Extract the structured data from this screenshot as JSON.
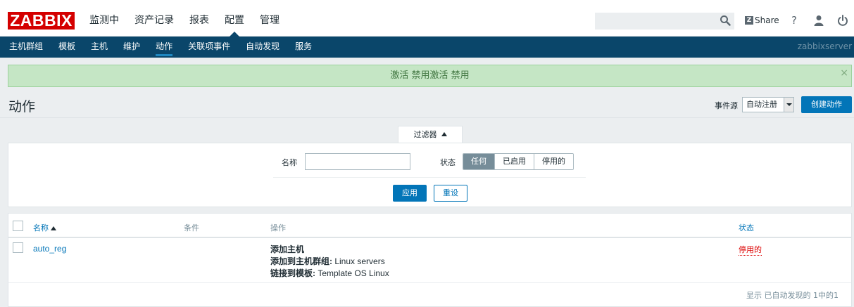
{
  "header": {
    "logo": "ZABBIX",
    "nav": [
      "监测中",
      "资产记录",
      "报表",
      "配置",
      "管理"
    ],
    "active_nav": "配置",
    "share_label": "Share",
    "help_label": "?"
  },
  "subnav": {
    "items": [
      "主机群组",
      "模板",
      "主机",
      "维护",
      "动作",
      "关联项事件",
      "自动发现",
      "服务"
    ],
    "active": "动作",
    "server": "zabbixserver"
  },
  "message": {
    "text": "激活 禁用激活 禁用",
    "close": "×"
  },
  "page": {
    "title": "动作",
    "source_label": "事件源",
    "source_value": "自动注册",
    "create_button": "创建动作"
  },
  "filter": {
    "tab_label": "过滤器",
    "name_label": "名称",
    "name_value": "",
    "status_label": "状态",
    "status_options": [
      "任何",
      "已启用",
      "停用的"
    ],
    "status_selected": "任何",
    "apply": "应用",
    "reset": "重设"
  },
  "table": {
    "columns": [
      "名称",
      "条件",
      "操作",
      "状态"
    ],
    "rows": [
      {
        "name": "auto_reg",
        "conditions": "",
        "operations": [
          {
            "label": "添加主机",
            "value": ""
          },
          {
            "label": "添加到主机群组:",
            "value": " Linux servers"
          },
          {
            "label": "链接到模板:",
            "value": " Template OS Linux"
          }
        ],
        "status": "停用的"
      }
    ],
    "footer": "显示 已自动发现的 1中的1"
  },
  "colors": {
    "brand_red": "#d40000",
    "nav_dark": "#0a466a",
    "accent_blue": "#0275b8",
    "success_bg": "#c5e6c5",
    "disabled_red": "#dc0000"
  }
}
